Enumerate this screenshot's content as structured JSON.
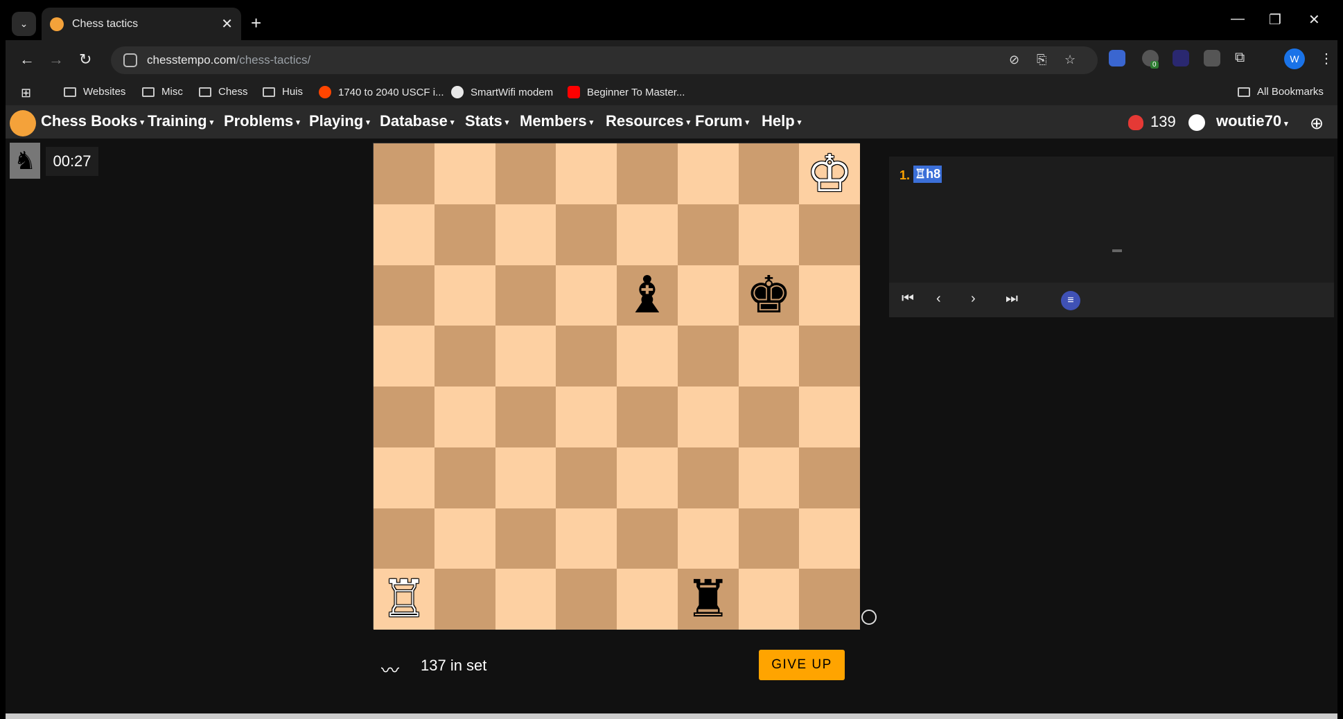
{
  "browser": {
    "tab_title": "Chess tactics",
    "new_tab_icon": "+",
    "address": {
      "domain": "chesstempo.com",
      "path": "/chess-tactics/"
    },
    "profile_initial": "W",
    "extension_badge": "0"
  },
  "bookmarks": [
    {
      "label": "Websites",
      "icon": "folder-icon"
    },
    {
      "label": "Misc",
      "icon": "folder-icon"
    },
    {
      "label": "Chess",
      "icon": "folder-icon"
    },
    {
      "label": "Huis",
      "icon": "folder-icon"
    },
    {
      "label": "1740 to 2040 USCF i...",
      "icon": "reddit-icon"
    },
    {
      "label": "SmartWifi modem",
      "icon": "globe-icon"
    },
    {
      "label": "Beginner To Master...",
      "icon": "youtube-icon"
    }
  ],
  "all_bookmarks_label": "All Bookmarks",
  "site_nav": {
    "items": [
      "Chess Books",
      "Training",
      "Problems",
      "Playing",
      "Database",
      "Stats",
      "Members",
      "Resources",
      "Forum",
      "Help"
    ],
    "rating": "139",
    "username": "woutie70"
  },
  "timer": {
    "value": "00:27",
    "piece_glyph": "♞"
  },
  "board": {
    "pieces": [
      {
        "square": "h8",
        "glyph": "♔",
        "color": "white"
      },
      {
        "square": "e6",
        "glyph": "♝",
        "color": "black"
      },
      {
        "square": "g6",
        "glyph": "♚",
        "color": "black"
      },
      {
        "square": "a1",
        "glyph": "♖",
        "color": "white"
      },
      {
        "square": "f1",
        "glyph": "♜",
        "color": "black"
      }
    ]
  },
  "footer": {
    "in_set": "137 in set",
    "give_up": "GIVE UP"
  },
  "moves": {
    "number": "1.",
    "san": "♖h8"
  },
  "colors": {
    "accent": "#ffa400",
    "highlight": "#3b6fd8",
    "light_square": "#fdd0a2",
    "dark_square": "#cc9d6f"
  }
}
